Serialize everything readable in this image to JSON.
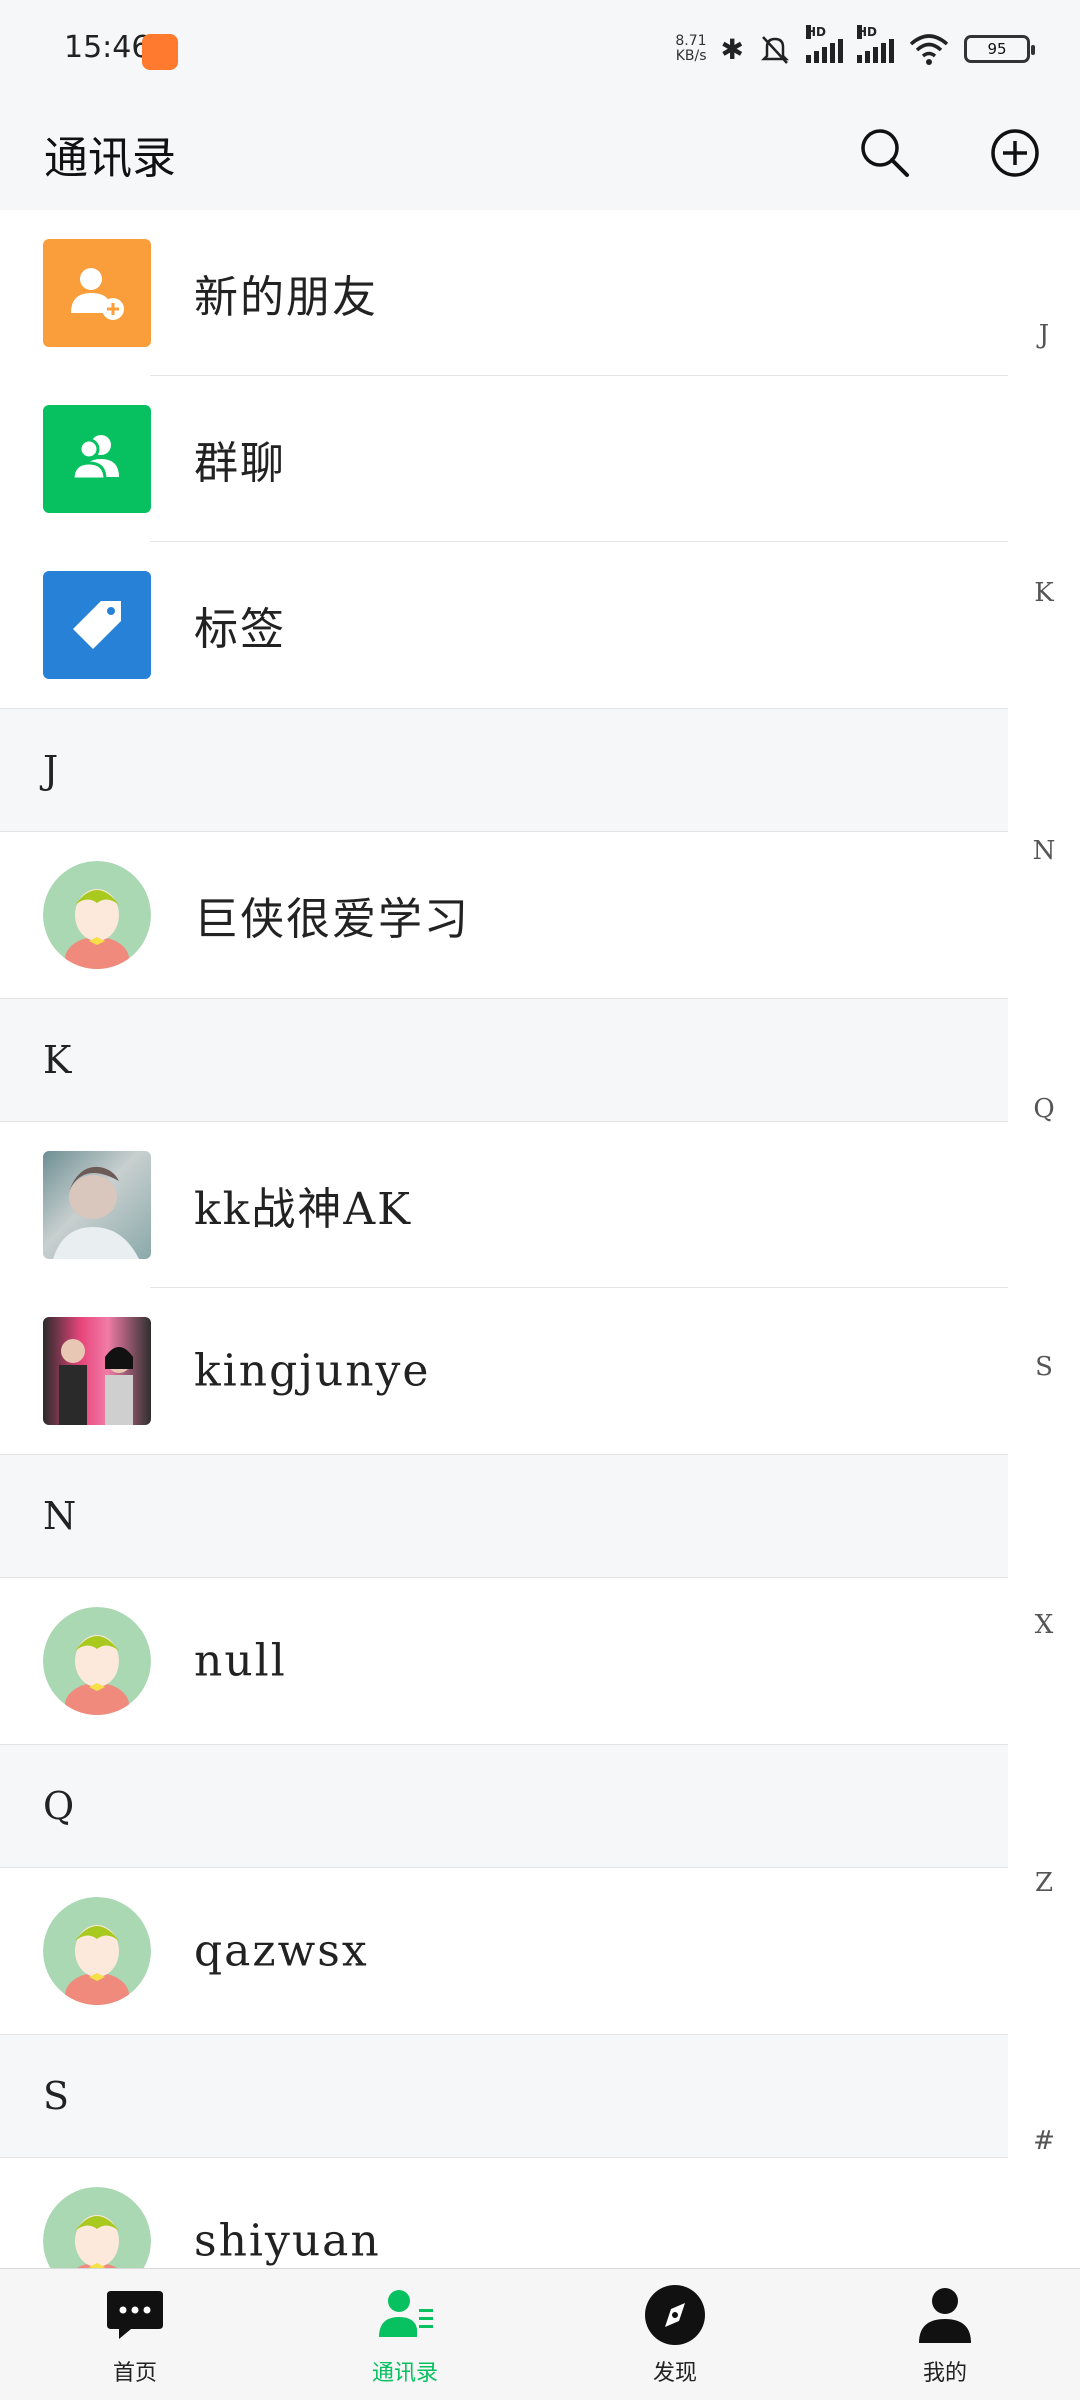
{
  "status_bar": {
    "time": "15:46",
    "net_speed_value": "8.71",
    "net_speed_unit": "KB/s",
    "battery": "95"
  },
  "header": {
    "title": "通讯录"
  },
  "functions": [
    {
      "label": "新的朋友",
      "icon": "add-friend-icon",
      "color": "#FA9D3B"
    },
    {
      "label": "群聊",
      "icon": "group-chat-icon",
      "color": "#07C160"
    },
    {
      "label": "标签",
      "icon": "tag-icon",
      "color": "#2782D7"
    }
  ],
  "sections": [
    {
      "letter": "J",
      "contacts": [
        {
          "name": "巨侠很爱学习",
          "avatar": "default-avatar"
        }
      ]
    },
    {
      "letter": "K",
      "contacts": [
        {
          "name": "kk战神AK",
          "avatar": "photo-avatar"
        },
        {
          "name": "kingjunye",
          "avatar": "photo-avatar"
        }
      ]
    },
    {
      "letter": "N",
      "contacts": [
        {
          "name": "null",
          "avatar": "default-avatar"
        }
      ]
    },
    {
      "letter": "Q",
      "contacts": [
        {
          "name": "qazwsx",
          "avatar": "default-avatar"
        }
      ]
    },
    {
      "letter": "S",
      "contacts": [
        {
          "name": "shiyuan",
          "avatar": "default-avatar"
        }
      ]
    }
  ],
  "index_bar": [
    "J",
    "K",
    "N",
    "Q",
    "S",
    "X",
    "Z",
    "#"
  ],
  "bottom_nav": [
    {
      "label": "首页",
      "icon": "chat-bubble-icon",
      "active": false
    },
    {
      "label": "通讯录",
      "icon": "contacts-icon",
      "active": true
    },
    {
      "label": "发现",
      "icon": "compass-icon",
      "active": false
    },
    {
      "label": "我的",
      "icon": "person-icon",
      "active": false
    }
  ],
  "colors": {
    "accent": "#07C160",
    "background": "#F6F7F9"
  }
}
